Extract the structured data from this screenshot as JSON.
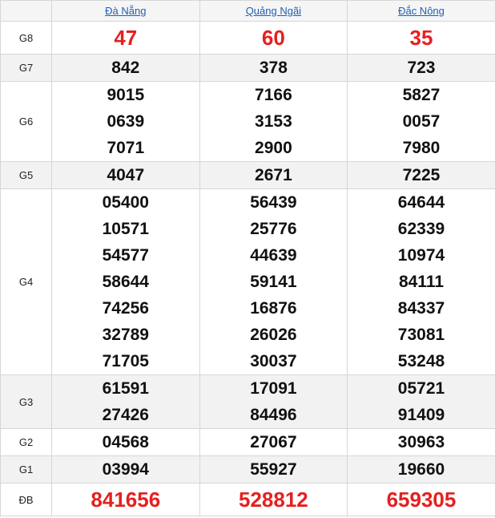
{
  "provinces": [
    "Đà Nẵng",
    "Quảng Ngãi",
    "Đắc Nông"
  ],
  "colors": {
    "accent_red": "#e52020",
    "link_blue": "#1f5fb8",
    "shade": "#f2f2f2"
  },
  "rows": [
    {
      "label": "G8",
      "shaded": false,
      "style": "g8",
      "cols": [
        [
          "47"
        ],
        [
          "60"
        ],
        [
          "35"
        ]
      ]
    },
    {
      "label": "G7",
      "shaded": true,
      "style": "normal",
      "cols": [
        [
          "842"
        ],
        [
          "378"
        ],
        [
          "723"
        ]
      ]
    },
    {
      "label": "G6",
      "shaded": false,
      "style": "normal",
      "cols": [
        [
          "9015",
          "0639",
          "7071"
        ],
        [
          "7166",
          "3153",
          "2900"
        ],
        [
          "5827",
          "0057",
          "7980"
        ]
      ]
    },
    {
      "label": "G5",
      "shaded": true,
      "style": "normal",
      "cols": [
        [
          "4047"
        ],
        [
          "2671"
        ],
        [
          "7225"
        ]
      ]
    },
    {
      "label": "G4",
      "shaded": false,
      "style": "normal",
      "cols": [
        [
          "05400",
          "10571",
          "54577",
          "58644",
          "74256",
          "32789",
          "71705"
        ],
        [
          "56439",
          "25776",
          "44639",
          "59141",
          "16876",
          "26026",
          "30037"
        ],
        [
          "64644",
          "62339",
          "10974",
          "84111",
          "84337",
          "73081",
          "53248"
        ]
      ]
    },
    {
      "label": "G3",
      "shaded": true,
      "style": "normal",
      "cols": [
        [
          "61591",
          "27426"
        ],
        [
          "17091",
          "84496"
        ],
        [
          "05721",
          "91409"
        ]
      ]
    },
    {
      "label": "G2",
      "shaded": false,
      "style": "normal",
      "cols": [
        [
          "04568"
        ],
        [
          "27067"
        ],
        [
          "30963"
        ]
      ]
    },
    {
      "label": "G1",
      "shaded": true,
      "style": "normal",
      "cols": [
        [
          "03994"
        ],
        [
          "55927"
        ],
        [
          "19660"
        ]
      ]
    },
    {
      "label": "ĐB",
      "shaded": false,
      "style": "special",
      "cols": [
        [
          "841656"
        ],
        [
          "528812"
        ],
        [
          "659305"
        ]
      ]
    }
  ]
}
